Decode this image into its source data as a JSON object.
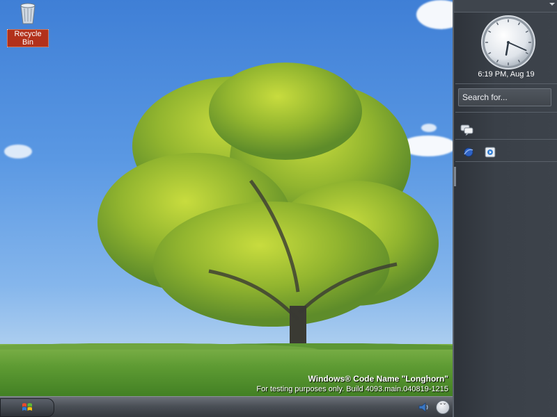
{
  "desktop": {
    "icons": [
      {
        "label": "Recycle Bin",
        "icon": "recycle-bin-icon"
      }
    ],
    "watermark": {
      "title": "Windows® Code Name \"Longhorn\"",
      "subtitle": "For testing purposes only. Build 4093.main.040819-1215"
    }
  },
  "taskbar": {
    "start_icon": "windows-flag-icon",
    "tray": [
      {
        "icon": "volume-icon"
      },
      {
        "icon": "expand-tray-icon"
      }
    ]
  },
  "sidebar": {
    "clock": {
      "time_label": "6:19 PM, Aug 19",
      "hour": 6,
      "minute": 19
    },
    "search": {
      "placeholder": "Search for..."
    },
    "tiles": [
      {
        "icon": "messenger-icon"
      },
      {
        "icon": "network-icon"
      },
      {
        "icon": "media-icon"
      }
    ]
  },
  "colors": {
    "sidebar_bg": "#3a4048",
    "label_highlight": "#b2311b"
  }
}
